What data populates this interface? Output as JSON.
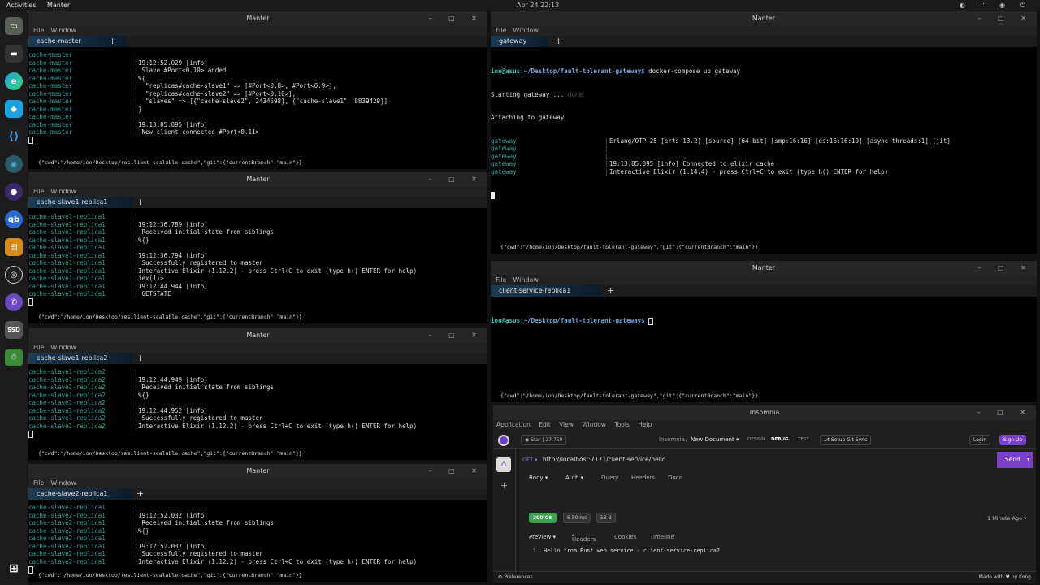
{
  "topbar": {
    "activities": "Activities",
    "app": "Manter",
    "clock": "Apr 24 22:13",
    "tray": "◐ ∷ ◉ ⏻"
  },
  "dock": [
    "files",
    "terminal",
    "edge-dev",
    "box",
    "vscode",
    "insomnia",
    "tor",
    "qbittorrent",
    "media",
    "obs",
    "viber",
    "ssd",
    "trash",
    "apps"
  ],
  "colors": {
    "prefix": "#2aa39a",
    "accent": "#7a3fc9",
    "ok": "#3aa34b"
  },
  "win_title": "Manter",
  "menu": {
    "file": "File",
    "window": "Window"
  },
  "controls": "– □ ✕",
  "cm": {
    "tab": "cache-master",
    "prefix": "cache-master",
    "lines": [
      "",
      "19:12:52.029 [info]",
      " Slave #Port<0.10> added",
      "%{",
      "  \"replicas#cache-slave1\" => [#Port<0.8>, #Port<0.9>],",
      "  \"replicas#cache-slave2\" => [#Port<0.10>],",
      "  \"slaves\" => [{\"cache-slave2\", 2434598}, {\"cache-slave1\", 8839429}]",
      "}",
      "",
      "19:13:05.095 [info]",
      " New client connected #Port<0.11>"
    ],
    "status": "{\"cwd\":\"/home/ion/Desktop/resilient-scalable-cache\",\"git\":{\"currentBranch\":\"main\"}}"
  },
  "s1r1": {
    "tab": "cache-slave1-replica1",
    "prefix": "cache-slave1-replica1",
    "lines": [
      "",
      "19:12:36.789 [info]",
      " Received initial state from siblings",
      "%{}",
      "",
      "19:12:36.794 [info]",
      " Successfully registered to master",
      "Interactive Elixir (1.12.2) - press Ctrl+C to exit (type h() ENTER for help)",
      "iex(1)>",
      "19:12:44.944 [info]",
      " GETSTATE"
    ],
    "status": "{\"cwd\":\"/home/ion/Desktop/resilient-scalable-cache\",\"git\":{\"currentBranch\":\"main\"}}"
  },
  "s1r2": {
    "tab": "cache-slave1-replica2",
    "prefix": "cache-slave1-replica2",
    "lines": [
      "",
      "19:12:44.949 [info]",
      " Received initial state from siblings",
      "%{}",
      "",
      "19:12:44.952 [info]",
      " Successfully registered to master",
      "Interactive Elixir (1.12.2) - press Ctrl+C to exit (type h() ENTER for help)"
    ],
    "status": "{\"cwd\":\"/home/ion/Desktop/resilient-scalable-cache\",\"git\":{\"currentBranch\":\"main\"}}"
  },
  "s2r1": {
    "tab": "cache-slave2-replica1",
    "prefix": "cache-slave2-replica1",
    "lines": [
      "",
      "19:12:52.032 [info]",
      " Received initial state from siblings",
      "%{}",
      "",
      "19:12:52.037 [info]",
      " Successfully registered to master",
      "Interactive Elixir (1.12.2) - press Ctrl+C to exit (type h() ENTER for help)"
    ],
    "status": "{\"cwd\":\"/home/ion/Desktop/resilient-scalable-cache\",\"git\":{\"currentBranch\":\"main\"}}"
  },
  "gw": {
    "tab": "gateway",
    "prompt_user": "ion@asus",
    "prompt_path": ":~/Desktop/fault-tolerant-gateway$",
    "cmd": " docker-compose up gateway",
    "starting": "Starting gateway ...",
    "done": " done",
    "attaching": "Attaching to gateway",
    "prefix": "gateway",
    "lines": [
      "Erlang/OTP 25 [erts-13.2] [source] [64-bit] [smp:16:16] [ds:16:16:10] [async-threads:1] [jit]",
      "",
      "",
      "19:13:05.095 [info] Connected to elixir cache",
      "Interactive Elixir (1.14.4) - press Ctrl+C to exit (type h() ENTER for help)"
    ],
    "status": "{\"cwd\":\"/home/ion/Desktop/fault-tolerant-gateway\",\"git\":{\"currentBranch\":\"main\"}}"
  },
  "cs": {
    "tab": "client-service-replica1",
    "prompt_user": "ion@asus",
    "prompt_path": ":~/Desktop/fault-tolerant-gateway$",
    "status": "{\"cwd\":\"/home/ion/Desktop/fault-tolerant-gateway\",\"git\":{\"currentBranch\":\"main\"}}"
  },
  "ins": {
    "title": "Insomnia",
    "menu": [
      "Application",
      "Edit",
      "View",
      "Window",
      "Tools",
      "Help"
    ],
    "star": "Star",
    "stars": "27,759",
    "workspace": "Insomnia",
    "sep": "/",
    "doc": "New Document ▾",
    "modes": [
      "DESIGN",
      "DEBUG",
      "TEST"
    ],
    "gitsync": "Setup Git Sync",
    "login": "Login",
    "signup": "Sign Up",
    "method": "GET ▾",
    "url": "http://localhost:7171/client-service/hello",
    "send": "Send",
    "req_tabs": [
      "Body ▾",
      "Auth ▾",
      "Query",
      "Headers",
      "Docs"
    ],
    "status_code": "200 OK",
    "time": "6.59 ms",
    "size": "53 B",
    "ago": "1 Minute Ago ▾",
    "resp_tabs": [
      "Preview ▾",
      "Headers",
      "Cookies",
      "Timeline"
    ],
    "headers_count": "4",
    "line_no": "1",
    "body": "Hello from Rust web service - client-service-replica2",
    "prefs": "Preferences",
    "made": "Made with ♥ by Kong"
  }
}
